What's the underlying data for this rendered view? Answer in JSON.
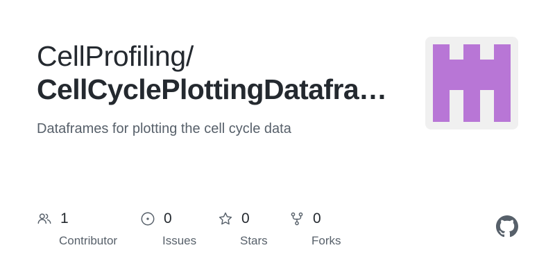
{
  "repo": {
    "owner": "CellProfiling/",
    "name": "CellCyclePlottingDatafra…",
    "description": "Dataframes for plotting the cell cycle data"
  },
  "stats": [
    {
      "icon": "people-icon",
      "value": "1",
      "label": "Contributor"
    },
    {
      "icon": "issue-icon",
      "value": "0",
      "label": "Issues"
    },
    {
      "icon": "star-icon",
      "value": "0",
      "label": "Stars"
    },
    {
      "icon": "fork-icon",
      "value": "0",
      "label": "Forks"
    }
  ],
  "colors": {
    "avatar_fill": "#b876d6",
    "avatar_bg": "#f0f0f0",
    "text": "#24292f",
    "muted": "#57606a"
  },
  "icons": {
    "brand": "github-mark-icon"
  }
}
